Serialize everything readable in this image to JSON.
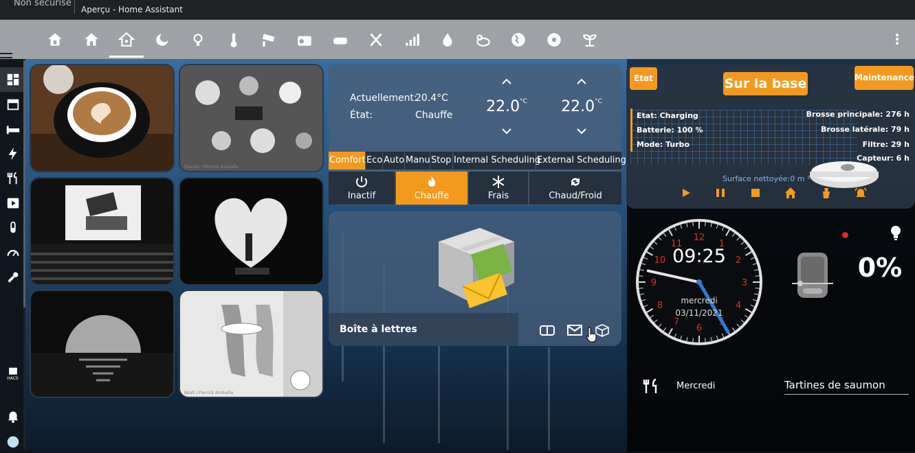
{
  "browser": {
    "security": "Non sécurisé",
    "tab_title": "Aperçu - Home Assistant"
  },
  "header": {
    "tabs": [
      "home-outline-icon",
      "home-icon",
      "home-automation-icon",
      "weather-night-icon",
      "lightbulb-icon",
      "thermometer-icon",
      "cctv-icon",
      "radio-icon",
      "sofa-icon",
      "silverware-icon",
      "signal-icon",
      "water-icon",
      "weather-partly-cloudy-icon",
      "earth-icon",
      "robot-vacuum-icon",
      "sprout-icon"
    ],
    "active_tab": "home-automation-icon"
  },
  "sidebar": {
    "items": [
      "view-dashboard-icon",
      "store-icon",
      "bed-icon",
      "lightning-icon",
      "silverware-icon",
      "play-box-icon",
      "test-tube-icon",
      "gauge-icon",
      "wrench-icon",
      "hacs-icon",
      "bell-icon"
    ],
    "hacs_label": "HACS"
  },
  "photos": {
    "cards": [
      {
        "name": "coffee-photo",
        "subject": "cappuccino"
      },
      {
        "name": "table-photo",
        "subject": "dinner table",
        "caption": "Stanley / Pierrick Anduelle"
      },
      {
        "name": "cinema-photo",
        "subject": "cinema"
      },
      {
        "name": "heart-photo",
        "subject": "heart"
      },
      {
        "name": "sunset-photo",
        "subject": "sunset"
      },
      {
        "name": "feet-photo",
        "subject": "bathroom",
        "caption": "Bkalt / Pierrick Anduelle"
      }
    ]
  },
  "thermostat": {
    "current_label": "Actuellement:",
    "current_value": "20.4°C",
    "state_label": "État:",
    "state_value": "Chauffe",
    "setpoint_low": "22.0",
    "setpoint_high": "22.0",
    "setpoint_unit": "°C",
    "presets": [
      "Comfort",
      "Eco",
      "Auto",
      "Manu",
      "Stop",
      "Internal Scheduling",
      "External Scheduling"
    ],
    "active_preset": "Comfort",
    "modes": [
      {
        "icon": "power-icon",
        "label": "Inactif"
      },
      {
        "icon": "fire-icon",
        "label": "Chauffe"
      },
      {
        "icon": "snowflake-icon",
        "label": "Frais"
      },
      {
        "icon": "sync-icon",
        "label": "Chaud/Froid"
      }
    ],
    "active_mode": "Chauffe"
  },
  "mailbox": {
    "label": "Boîte à lettres",
    "icons": [
      "mailbox-icon",
      "email-icon",
      "package-icon"
    ]
  },
  "robot": {
    "state_button": "Etat",
    "status_title": "Sur la base",
    "maintenance_button": "Maintenance",
    "status_lines": [
      "Etat: Charging",
      "Batterie: 100 %",
      "Mode: Turbo"
    ],
    "consumables": [
      "Brosse principale: 276 h",
      "Brosse latérale: 79 h",
      "Filtre: 29 h",
      "Capteur: 6 h"
    ],
    "surface": "Surface nettoyée:0 m ²",
    "controls": [
      "play-icon",
      "pause-icon",
      "stop-icon",
      "home-icon",
      "broom-icon",
      "bell-ring-icon"
    ],
    "accent": "#f39a1e"
  },
  "clock": {
    "time": "09:25",
    "day": "mercredi",
    "date": "03/11/2021",
    "numbers": [
      "12",
      "1",
      "2",
      "3",
      "4",
      "5",
      "6",
      "7",
      "8",
      "9",
      "10",
      "11"
    ],
    "hour": 9.416,
    "minute": 25
  },
  "cover": {
    "position": "0%",
    "state_color": "#e02828"
  },
  "meal": {
    "icon": "silverware-icon",
    "day": "Mercredi",
    "dish": "Tartines de saumon"
  }
}
